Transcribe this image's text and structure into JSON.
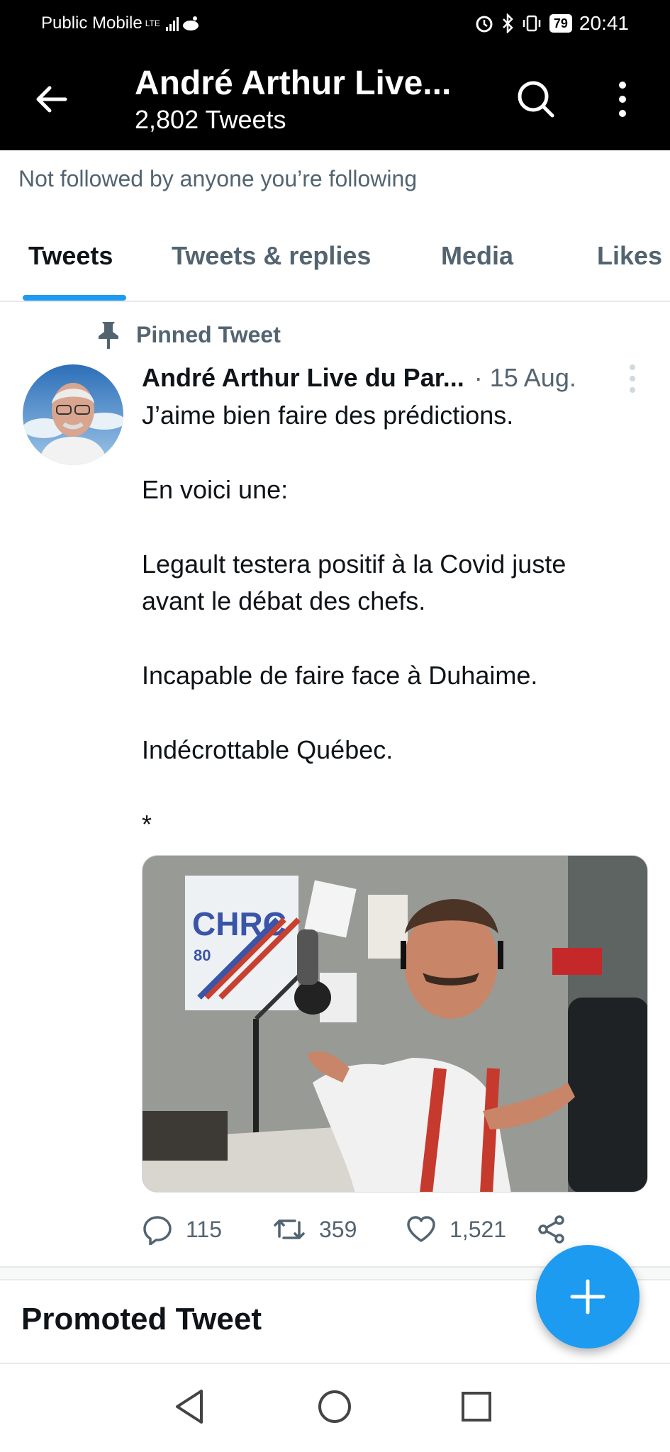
{
  "status_bar": {
    "carrier": "Public Mobile",
    "network_badge": "LTE",
    "battery": "79",
    "time": "20:41"
  },
  "header": {
    "title": "André Arthur Live...",
    "tweet_count": "2,802 Tweets"
  },
  "follow_note": "Not followed by anyone you’re following",
  "tabs": [
    {
      "label": "Tweets",
      "active": true
    },
    {
      "label": "Tweets & replies",
      "active": false
    },
    {
      "label": "Media",
      "active": false
    },
    {
      "label": "Likes",
      "active": false
    }
  ],
  "tweet": {
    "pinned_label": "Pinned Tweet",
    "author": "André Arthur Live du Par...",
    "date": "· 15 Aug.",
    "lines": [
      "J’aime bien faire des prédictions.",
      "En voici une:",
      "Legault testera positif à la Covid juste avant le débat des chefs.",
      "Incapable de faire face à Duhaime.",
      "Indécrottable Québec.",
      "*"
    ],
    "media_sign": "CHRC",
    "media_sign_number": "80",
    "replies": "115",
    "retweets": "359",
    "likes": "1,521"
  },
  "promoted_label": "Promoted Tweet",
  "colors": {
    "accent": "#1d9bf0",
    "secondary_text": "#536471",
    "primary_text": "#0f1419",
    "header_bg": "#000000"
  },
  "icons": {
    "back": "arrow-left-icon",
    "search": "search-icon",
    "more": "more-vertical-icon",
    "pin": "pin-icon",
    "reply": "comment-icon",
    "retweet": "retweet-icon",
    "like": "heart-icon",
    "share": "share-icon",
    "compose": "plus-icon"
  }
}
